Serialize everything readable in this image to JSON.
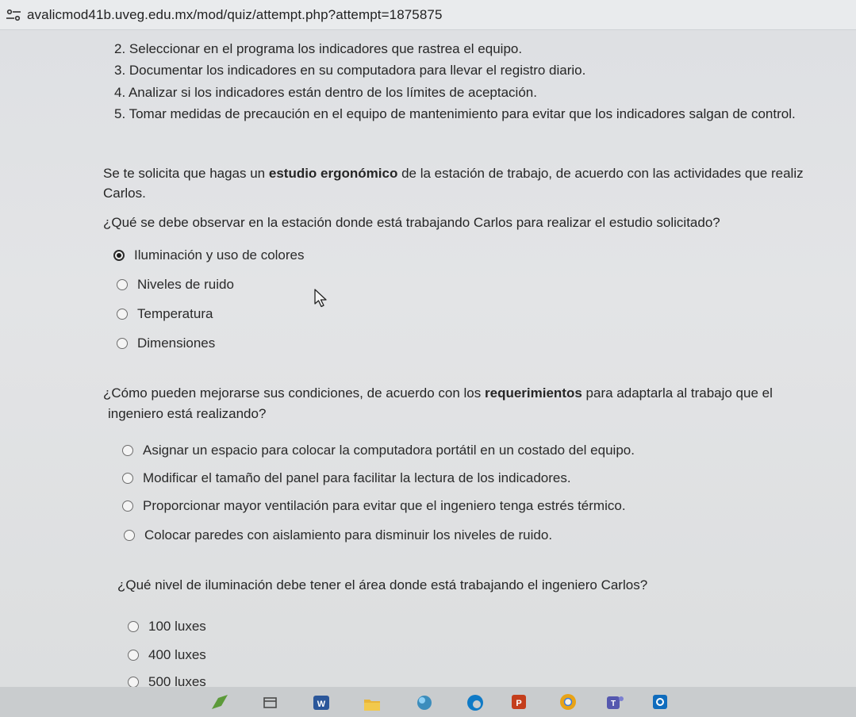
{
  "browser": {
    "url": "avalicmod41b.uveg.edu.mx/mod/quiz/attempt.php?attempt=1875875",
    "site_icon": "tune-icon"
  },
  "steps": [
    "2. Seleccionar en el programa los indicadores que rastrea el equipo.",
    "3. Documentar los indicadores en su computadora para llevar el registro diario.",
    "4. Analizar si los indicadores están dentro de los límites de aceptación.",
    "5. Tomar medidas de precaución en el equipo de mantenimiento para evitar que los indicadores salgan de control."
  ],
  "scenario": {
    "prefix": "Se te solicita que hagas un ",
    "bold": "estudio ergonómico",
    "suffix": " de la estación de trabajo, de acuerdo con las actividades que realiz",
    "line2": "Carlos."
  },
  "questions": [
    {
      "text": "¿Qué se debe observar en la estación donde está trabajando Carlos para realizar el estudio solicitado?",
      "options": [
        {
          "label": "Iluminación y uso de colores",
          "selected": true
        },
        {
          "label": "Niveles de ruido",
          "selected": false
        },
        {
          "label": "Temperatura",
          "selected": false
        },
        {
          "label": "Dimensiones",
          "selected": false
        }
      ]
    },
    {
      "text_prefix": "¿Cómo pueden mejorarse sus condiciones, de acuerdo con los ",
      "text_bold": "requerimientos",
      "text_suffix": " para adaptarla al trabajo que el",
      "text_line2": "ingeniero está realizando?",
      "options": [
        {
          "label": "Asignar un espacio para colocar la computadora portátil en un costado del equipo.",
          "selected": false
        },
        {
          "label": "Modificar el tamaño del panel para facilitar la lectura de los indicadores.",
          "selected": false
        },
        {
          "label": "Proporcionar mayor ventilación para evitar que el ingeniero tenga estrés térmico.",
          "selected": false
        },
        {
          "label": "Colocar paredes con aislamiento para disminuir los niveles de ruido.",
          "selected": false
        }
      ]
    },
    {
      "text": "¿Qué nivel de iluminación debe tener el área donde está trabajando el ingeniero Carlos?",
      "options": [
        {
          "label": "100 luxes",
          "selected": false
        },
        {
          "label": "400 luxes",
          "selected": false
        },
        {
          "label": "500 luxes",
          "selected": false
        }
      ]
    }
  ],
  "taskbar": {
    "icons": [
      "green-app-icon",
      "calendar-icon",
      "word-icon",
      "folder-icon",
      "photos-icon",
      "edge-icon",
      "powerpoint-icon",
      "chrome-icon",
      "teams-icon",
      "outlook-icon"
    ],
    "colors": {
      "word": "#2b579a",
      "powerpoint": "#c43e1c",
      "edge": "#0f7ac6",
      "chrome": "#e8a317",
      "teams": "#5558af",
      "outlook": "#0f6cbd"
    }
  }
}
